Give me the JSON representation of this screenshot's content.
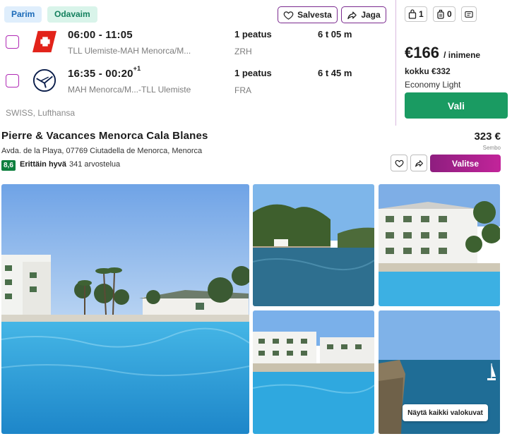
{
  "flight": {
    "badges": {
      "best": "Parim",
      "cheapest": "Odavaim"
    },
    "actions": {
      "save": "Salvesta",
      "share": "Jaga"
    },
    "legs": [
      {
        "airline_icon": "swiss-logo",
        "time": "06:00 - 11:05",
        "day_offset": "",
        "route": "TLL Ulemiste-MAH Menorca/M...",
        "stops": "1 peatus",
        "via": "ZRH",
        "duration": "6 t 05 m"
      },
      {
        "airline_icon": "lufthansa-logo",
        "time": "16:35 - 00:20",
        "day_offset": "+1",
        "route": "MAH Menorca/M...-TLL Ulemiste",
        "stops": "1 peatus",
        "via": "FRA",
        "duration": "6 t 45 m"
      }
    ],
    "carriers": "SWISS, Lufthansa",
    "baggage": {
      "personal_item": "1",
      "carry_on": "0",
      "checked_icon": "checked-bag-icon"
    },
    "price": "€166",
    "price_unit": "/ inimene",
    "total": "kokku €332",
    "fare_class": "Economy Light",
    "select_label": "Vali"
  },
  "hotel": {
    "name": "Pierre & Vacances Menorca Cala Blanes",
    "address": "Avda. de la Playa, 07769 Ciutadella de Menorca, Menorca",
    "rating_score": "8,6",
    "rating_word": "Erittäin hyvä",
    "rating_count": "341 arvostelua",
    "price": "323 €",
    "price_note": "Sembo",
    "choose_label": "Valitse",
    "show_all_photos": "Näytä kaikki valokuvat"
  },
  "colors": {
    "accent_purple": "#7b2a8f",
    "select_green": "#1a9b62",
    "choose_gradient_start": "#8e1e7f",
    "choose_gradient_end": "#c2249a",
    "rating_green": "#0e7f3e"
  }
}
